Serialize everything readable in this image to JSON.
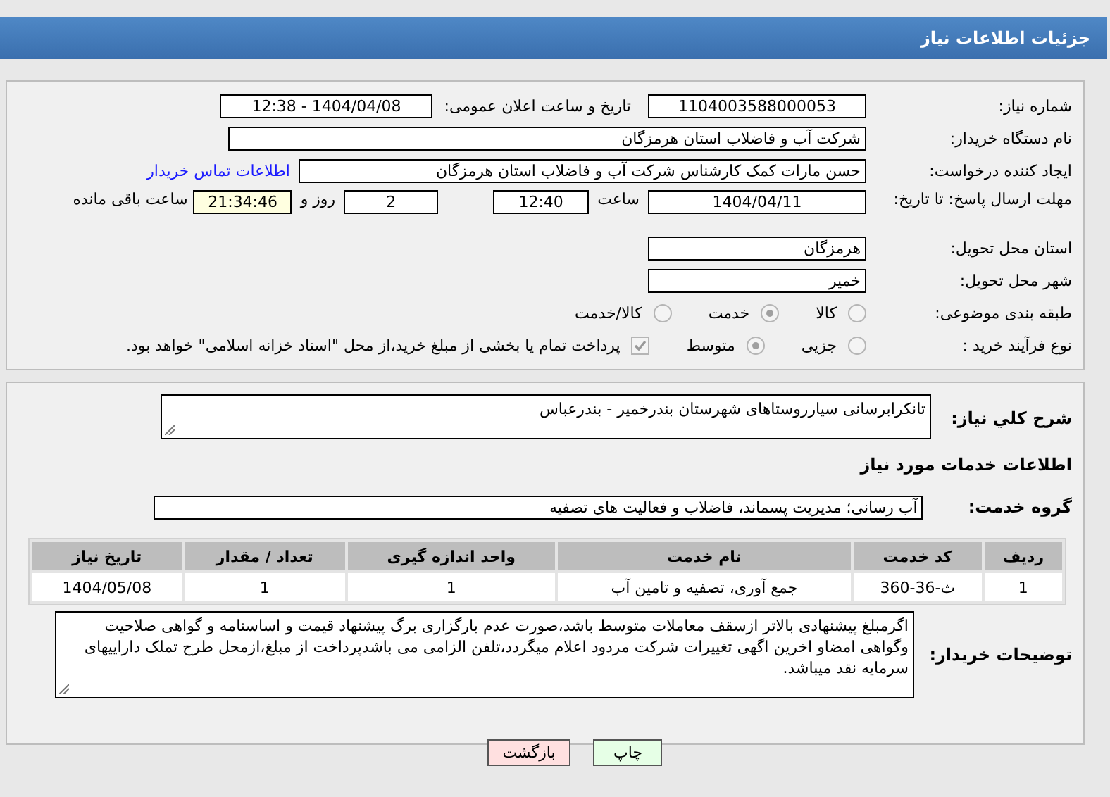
{
  "header": {
    "title": "جزئیات اطلاعات نیاز"
  },
  "need_number": {
    "label": "شماره نیاز:",
    "value": "1104003588000053"
  },
  "announce": {
    "label": "تاریخ و ساعت اعلان عمومی:",
    "value": "1404/04/08 - 12:38"
  },
  "buyer": {
    "label": "نام دستگاه خریدار:",
    "value": "شرکت آب و فاضلاب استان هرمزگان"
  },
  "requester": {
    "label": "ایجاد کننده درخواست:",
    "value": "حسن مارات کمک کارشناس شرکت آب و فاضلاب استان هرمزگان",
    "link": "اطلاعات تماس خریدار"
  },
  "deadline": {
    "label": "مهلت ارسال پاسخ: تا تاریخ:",
    "date": "1404/04/11",
    "time_label": "ساعت",
    "time": "12:40",
    "days": "2",
    "days_label": "روز و",
    "remaining": "21:34:46",
    "remaining_label": "ساعت باقی مانده"
  },
  "province": {
    "label": "استان محل تحویل:",
    "value": "هرمزگان"
  },
  "city": {
    "label": "شهر محل تحویل:",
    "value": "خمیر"
  },
  "category": {
    "label": "طبقه بندی موضوعی:",
    "options": [
      {
        "label": "کالا",
        "selected": false
      },
      {
        "label": "خدمت",
        "selected": true
      },
      {
        "label": "کالا/خدمت",
        "selected": false
      }
    ]
  },
  "process": {
    "label": "نوع فرآیند خرید :",
    "options": [
      {
        "label": "جزیی",
        "selected": false
      },
      {
        "label": "متوسط",
        "selected": true
      }
    ],
    "payment": {
      "checked": true,
      "text": "پرداخت تمام یا بخشی از مبلغ خرید،از محل \"اسناد خزانه اسلامی\" خواهد بود."
    }
  },
  "description": {
    "label": "شرح کلي نياز:",
    "value": "تانکرابرسانی سیارروستاهای شهرستان بندرخمیر - بندرعباس"
  },
  "services_heading": "اطلاعات خدمات مورد نیاز",
  "service_group": {
    "label": "گروه خدمت:",
    "value": "آب رسانی؛ مدیریت پسماند، فاضلاب و فعالیت های تصفیه"
  },
  "table": {
    "columns": [
      "ردیف",
      "کد خدمت",
      "نام خدمت",
      "واحد اندازه گیری",
      "تعداد / مقدار",
      "تاریخ نیاز"
    ],
    "rows": [
      [
        "1",
        "ث-36-360",
        "جمع آوری، تصفیه و تامین آب",
        "1",
        "1",
        "1404/05/08"
      ]
    ]
  },
  "buyer_notes": {
    "label": "توضیحات خریدار:",
    "value": "اگرمبلغ پیشنهادی بالاتر ازسقف معاملات متوسط باشد،صورت عدم بارگزاری برگ پیشنهاد قیمت و اساسنامه و گواهی صلاحیت وگواهی امضاو اخرین اگهی تغییرات شرکت مردود اعلام میگردد،تلفن الزامی می باشدپرداخت از مبلغ،ازمحل طرح تملک داراییهای سرمایه نقد میباشد."
  },
  "buttons": [
    {
      "label": "چاپ",
      "kind": "print"
    },
    {
      "label": "بازگشت",
      "kind": "back"
    }
  ]
}
